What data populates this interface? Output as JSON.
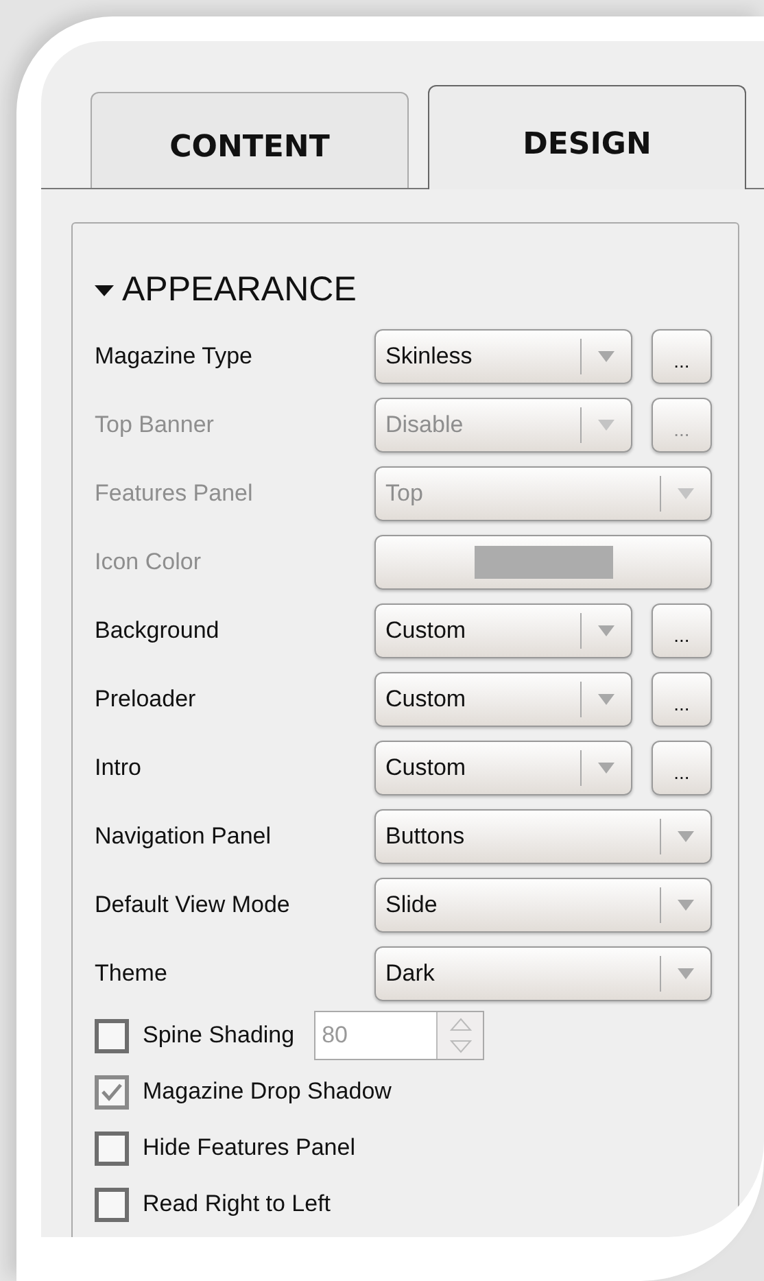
{
  "tabs": [
    {
      "label": "CONTENT",
      "selected": false
    },
    {
      "label": "DESIGN",
      "selected": true
    }
  ],
  "section": {
    "title": "APPEARANCE",
    "expanded": true
  },
  "settings": [
    {
      "kind": "select",
      "label": "Magazine Type",
      "value": "Skinless",
      "disabled": false,
      "more_button": "..."
    },
    {
      "kind": "select",
      "label": "Top Banner",
      "value": "Disable",
      "disabled": true,
      "more_button": "..."
    },
    {
      "kind": "select",
      "label": "Features Panel",
      "value": "Top",
      "disabled": true
    },
    {
      "kind": "color",
      "label": "Icon Color",
      "color": "#acacac",
      "disabled": true
    },
    {
      "kind": "select",
      "label": "Background",
      "value": "Custom",
      "disabled": false,
      "more_button": "..."
    },
    {
      "kind": "select",
      "label": "Preloader",
      "value": "Custom",
      "disabled": false,
      "more_button": "..."
    },
    {
      "kind": "select",
      "label": "Intro",
      "value": "Custom",
      "disabled": false,
      "more_button": "..."
    },
    {
      "kind": "select",
      "label": "Navigation Panel",
      "value": "Buttons",
      "disabled": false
    },
    {
      "kind": "select",
      "label": "Default View Mode",
      "value": "Slide",
      "disabled": false
    },
    {
      "kind": "select",
      "label": "Theme",
      "value": "Dark",
      "disabled": false
    }
  ],
  "options": [
    {
      "label": "Spine Shading",
      "checked": false,
      "spin_value": "80"
    },
    {
      "label": "Magazine Drop Shadow",
      "checked": true
    },
    {
      "label": "Hide Features Panel",
      "checked": false
    },
    {
      "label": "Read Right to Left",
      "checked": false
    }
  ]
}
